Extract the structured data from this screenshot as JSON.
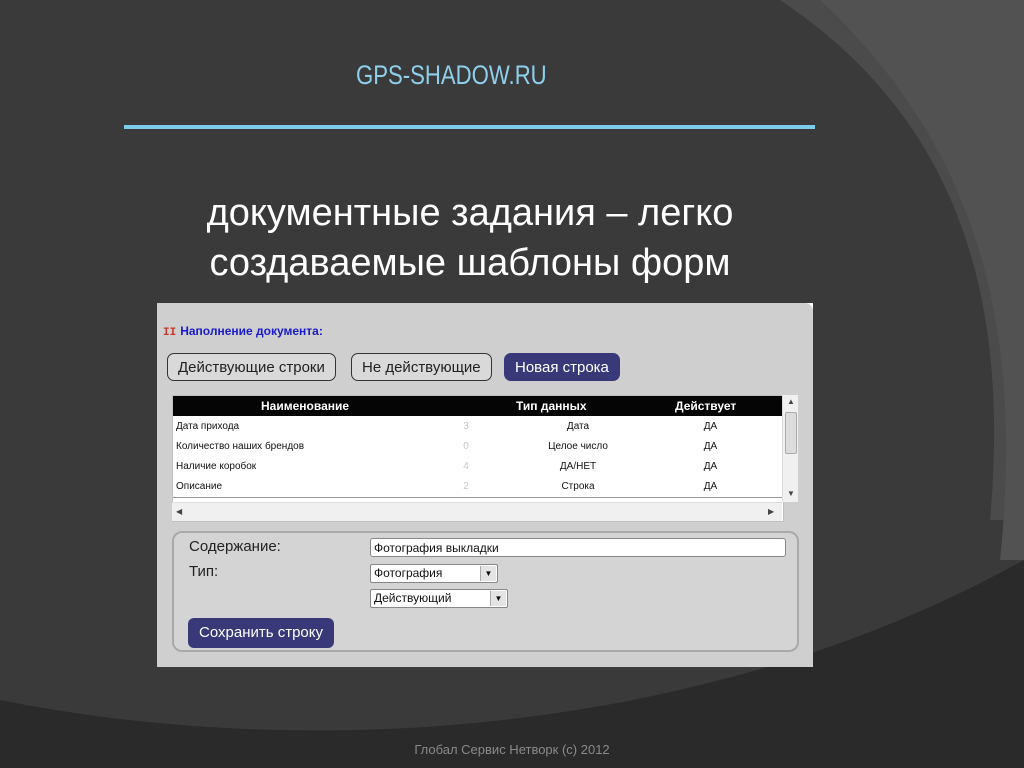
{
  "slide": {
    "site_title": "GPS-SHADOW.RU",
    "headline": "документные задания – легко создаваемые шаблоны форм",
    "footer": "Глобал Сервис Нетворк (c) 2012"
  },
  "app": {
    "section_title": "Наполнение документа:",
    "section_mark": "II",
    "tabs": {
      "active_rows": "Действующие строки",
      "inactive_rows": "Не действующие",
      "new_row": "Новая строка"
    },
    "table": {
      "columns": [
        "Наименование",
        "Тип данных",
        "Действует"
      ],
      "rows": [
        {
          "name": "Дата прихода",
          "num": "3",
          "type": "Дата",
          "active": "ДА"
        },
        {
          "name": "Количество наших брендов",
          "num": "0",
          "type": "Целое число",
          "active": "ДА"
        },
        {
          "name": "Наличие коробок",
          "num": "4",
          "type": "ДА/НЕТ",
          "active": "ДА"
        },
        {
          "name": "Описание",
          "num": "2",
          "type": "Строка",
          "active": "ДА"
        }
      ]
    },
    "form": {
      "content_label": "Содержание:",
      "content_value": "Фотография выкладки",
      "type_label": "Тип:",
      "type_value": "Фотография",
      "status_value": "Действующий",
      "save_label": "Сохранить строку"
    }
  },
  "colors": {
    "background": "#3a3a3a",
    "accent": "#7ccbe8",
    "button_dark": "#39397a"
  }
}
